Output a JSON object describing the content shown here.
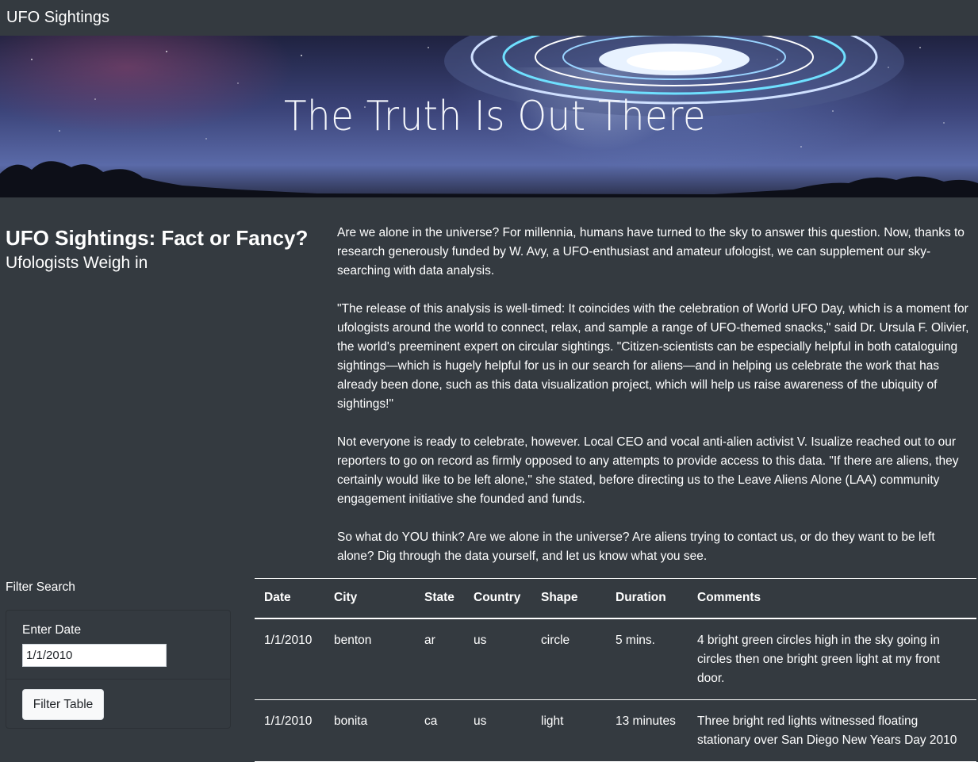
{
  "nav": {
    "brand": "UFO Sightings"
  },
  "hero": {
    "title": "The Truth Is Out There"
  },
  "headline": {
    "title": "UFO Sightings: Fact or Fancy?",
    "subtitle": "Ufologists Weigh in"
  },
  "article": {
    "paragraphs": [
      "Are we alone in the universe? For millennia, humans have turned to the sky to answer this question. Now, thanks to research generously funded by W. Avy, a UFO-enthusiast and amateur ufologist, we can supplement our sky-searching with data analysis.",
      "\"The release of this analysis is well-timed: It coincides with the celebration of World UFO Day, which is a moment for ufologists around the world to connect, relax, and sample a range of UFO-themed snacks,\" said Dr. Ursula F. Olivier, the world's preeminent expert on circular sightings. \"Citizen-scientists can be especially helpful in both cataloguing sightings—which is hugely helpful for us in our search for aliens—and in helping us celebrate the work that has already been done, such as this data visualization project, which will help us raise awareness of the ubiquity of sightings!\"",
      "Not everyone is ready to celebrate, however. Local CEO and vocal anti-alien activist V. Isualize reached out to our reporters to go on record as firmly opposed to any attempts to provide access to this data. \"If there are aliens, they certainly would like to be left alone,\" she stated, before directing us to the Leave Aliens Alone (LAA) community engagement initiative she founded and funds.",
      "So what do YOU think? Are we alone in the universe? Are aliens trying to contact us, or do they want to be left alone? Dig through the data yourself, and let us know what you see."
    ]
  },
  "filter": {
    "section_label": "Filter Search",
    "date_label": "Enter Date",
    "date_value": "1/1/2010",
    "button_label": "Filter Table"
  },
  "table": {
    "headers": [
      "Date",
      "City",
      "State",
      "Country",
      "Shape",
      "Duration",
      "Comments"
    ],
    "rows": [
      [
        "1/1/2010",
        "benton",
        "ar",
        "us",
        "circle",
        "5 mins.",
        "4 bright green circles high in the sky going in circles then one bright green light at my front door."
      ],
      [
        "1/1/2010",
        "bonita",
        "ca",
        "us",
        "light",
        "13 minutes",
        "Three bright red lights witnessed floating stationary over San Diego New Years Day 2010"
      ]
    ]
  },
  "colors": {
    "background": "#343a40",
    "text": "#ffffff",
    "button_bg": "#f8f9fa"
  },
  "icons": {
    "hero_art": "ufo-illustration"
  }
}
